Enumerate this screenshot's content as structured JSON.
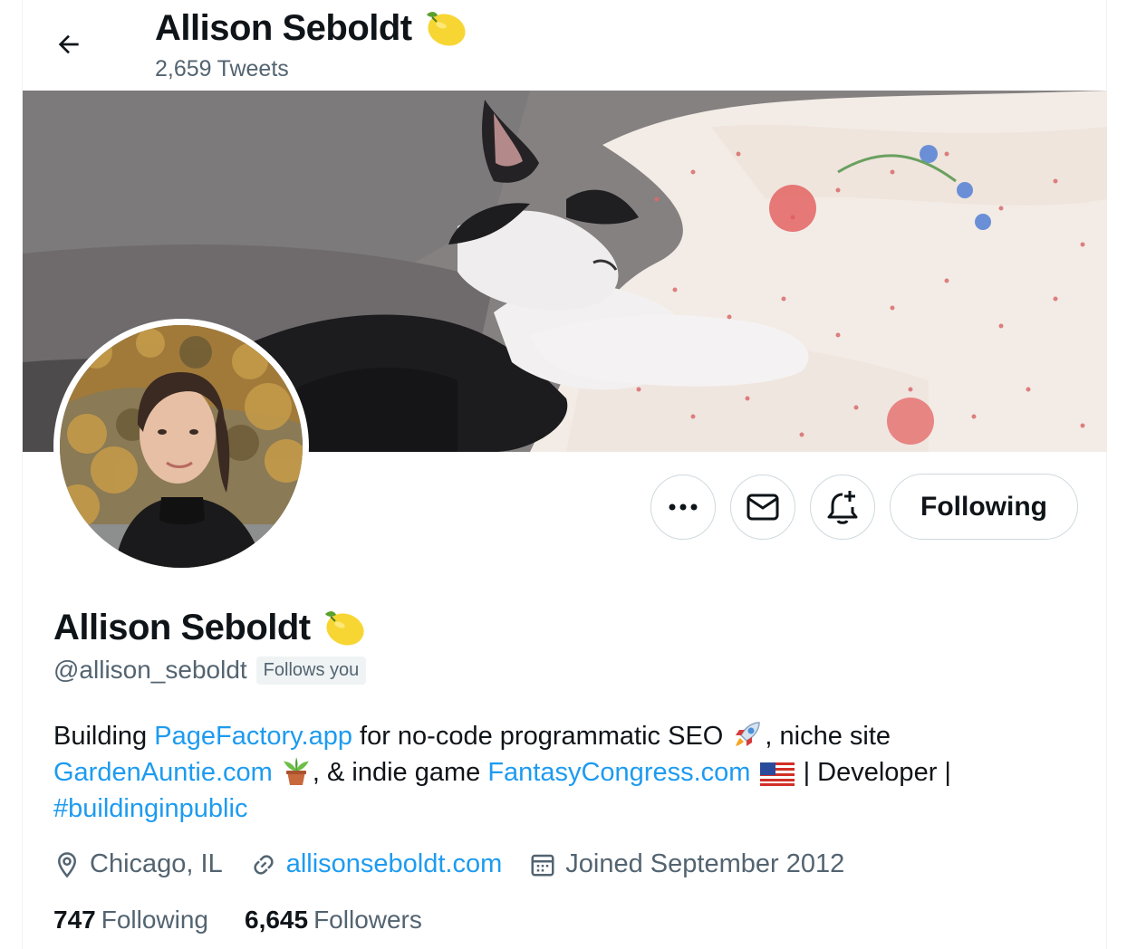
{
  "header": {
    "display_name": "Allison Seboldt",
    "tweet_count": "2,659",
    "tweet_label": "Tweets",
    "name_emoji": "lemon-icon"
  },
  "actions": {
    "more": "more-icon",
    "message": "mail-icon",
    "notify": "bell-plus-icon",
    "follow_label": "Following"
  },
  "profile": {
    "display_name": "Allison Seboldt",
    "handle": "@allison_seboldt",
    "follows_you": "Follows you"
  },
  "bio": {
    "t1": "Building ",
    "link1": "PageFactory.app",
    "t2": " for no-code programmatic SEO ",
    "t3": ", niche site ",
    "link2": "GardenAuntie.com",
    "t4": ", & indie game ",
    "link3": "FantasyCongress.com",
    "t5": " | Developer | ",
    "hashtag": "#buildinginpublic"
  },
  "meta": {
    "location": "Chicago, IL",
    "website": "allisonseboldt.com",
    "joined": "Joined September 2012"
  },
  "stats": {
    "following_count": "747",
    "following_label": "Following",
    "followers_count": "6,645",
    "followers_label": "Followers"
  },
  "colors": {
    "accent": "#1d9bf0",
    "text": "#0f1419",
    "secondary": "#536471"
  }
}
